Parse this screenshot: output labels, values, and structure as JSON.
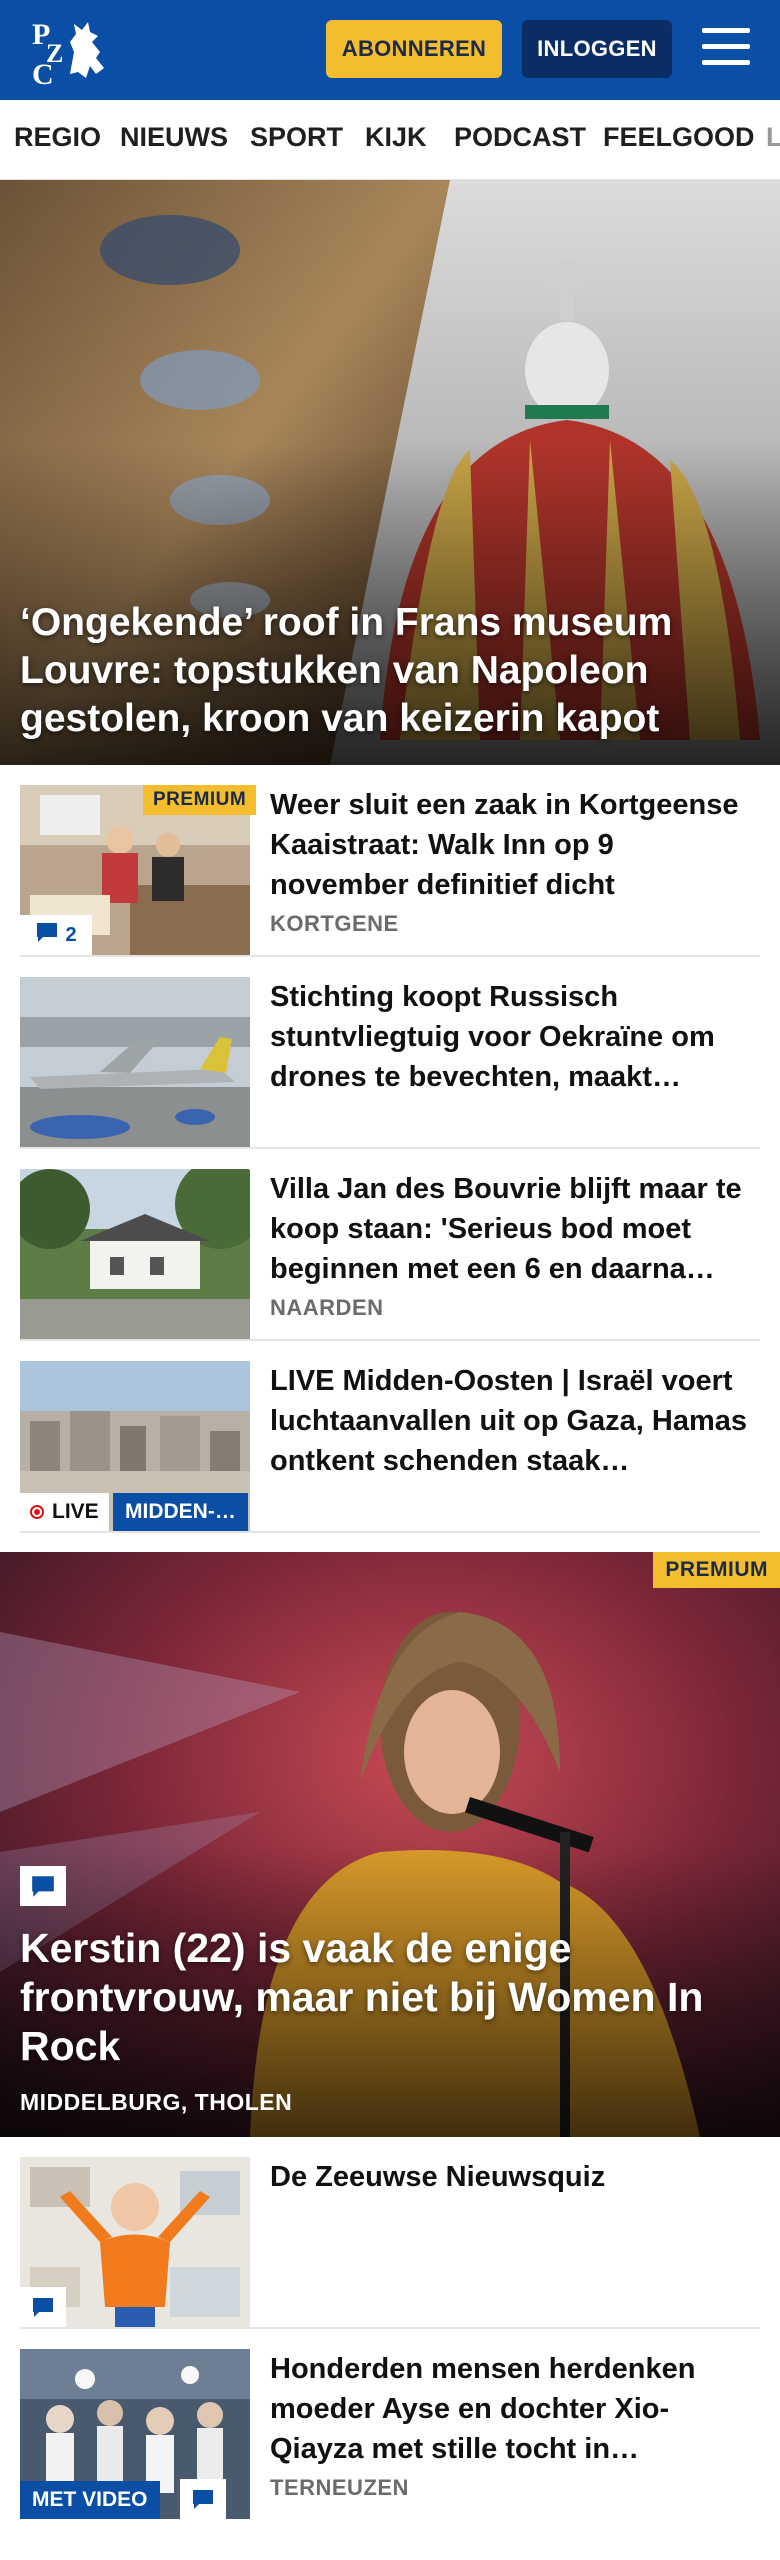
{
  "header": {
    "logo_text": "PZC",
    "subscribe_label": "ABONNEREN",
    "login_label": "INLOGGEN",
    "brand_color": "#0a4ea6",
    "accent_color": "#f3bd2e"
  },
  "nav": {
    "items": [
      "REGIO",
      "NIEUWS",
      "SPORT",
      "KIJK",
      "PODCAST",
      "FEELGOOD",
      "L"
    ]
  },
  "hero": {
    "title": "‘Ongekende’ roof in Frans museum Louvre: topstukken van Napoleon gestolen, kroon van keizerin kapot"
  },
  "articles": [
    {
      "title": "Weer sluit een zaak in Kortgeense Kaaistraat: Walk Inn op 9 november definitief dicht",
      "location": "KORTGENE",
      "premium_label": "PREMIUM",
      "comments": "2"
    },
    {
      "title": "Stichting koopt Russisch stuntvliegtuig voor Oekraïne om drones te bevechten, maakt…"
    },
    {
      "title": "Villa Jan des Bouvrie blijft maar te koop staan: 'Serieus bod moet beginnen met een 6 en daarna…",
      "location": "NAARDEN"
    },
    {
      "title": "LIVE Midden-Oosten | Israël voert luchtaanvallen uit op Gaza, Hamas ontkent schenden staak…",
      "live_label": "LIVE",
      "tag_label": "MIDDEN-…"
    }
  ],
  "feature": {
    "premium_label": "PREMIUM",
    "title": "Kerstin (22) is vaak de enige frontvrouw, maar niet bij Women In Rock",
    "location": "MIDDELBURG, THOLEN"
  },
  "articles2": [
    {
      "title": "De Zeeuwse Nieuwsquiz"
    },
    {
      "title": "Honderden mensen herdenken moeder Ayse en dochter Xio-Qiayza met stille tocht in…",
      "location": "TERNEUZEN",
      "video_label": "MET VIDEO"
    }
  ]
}
